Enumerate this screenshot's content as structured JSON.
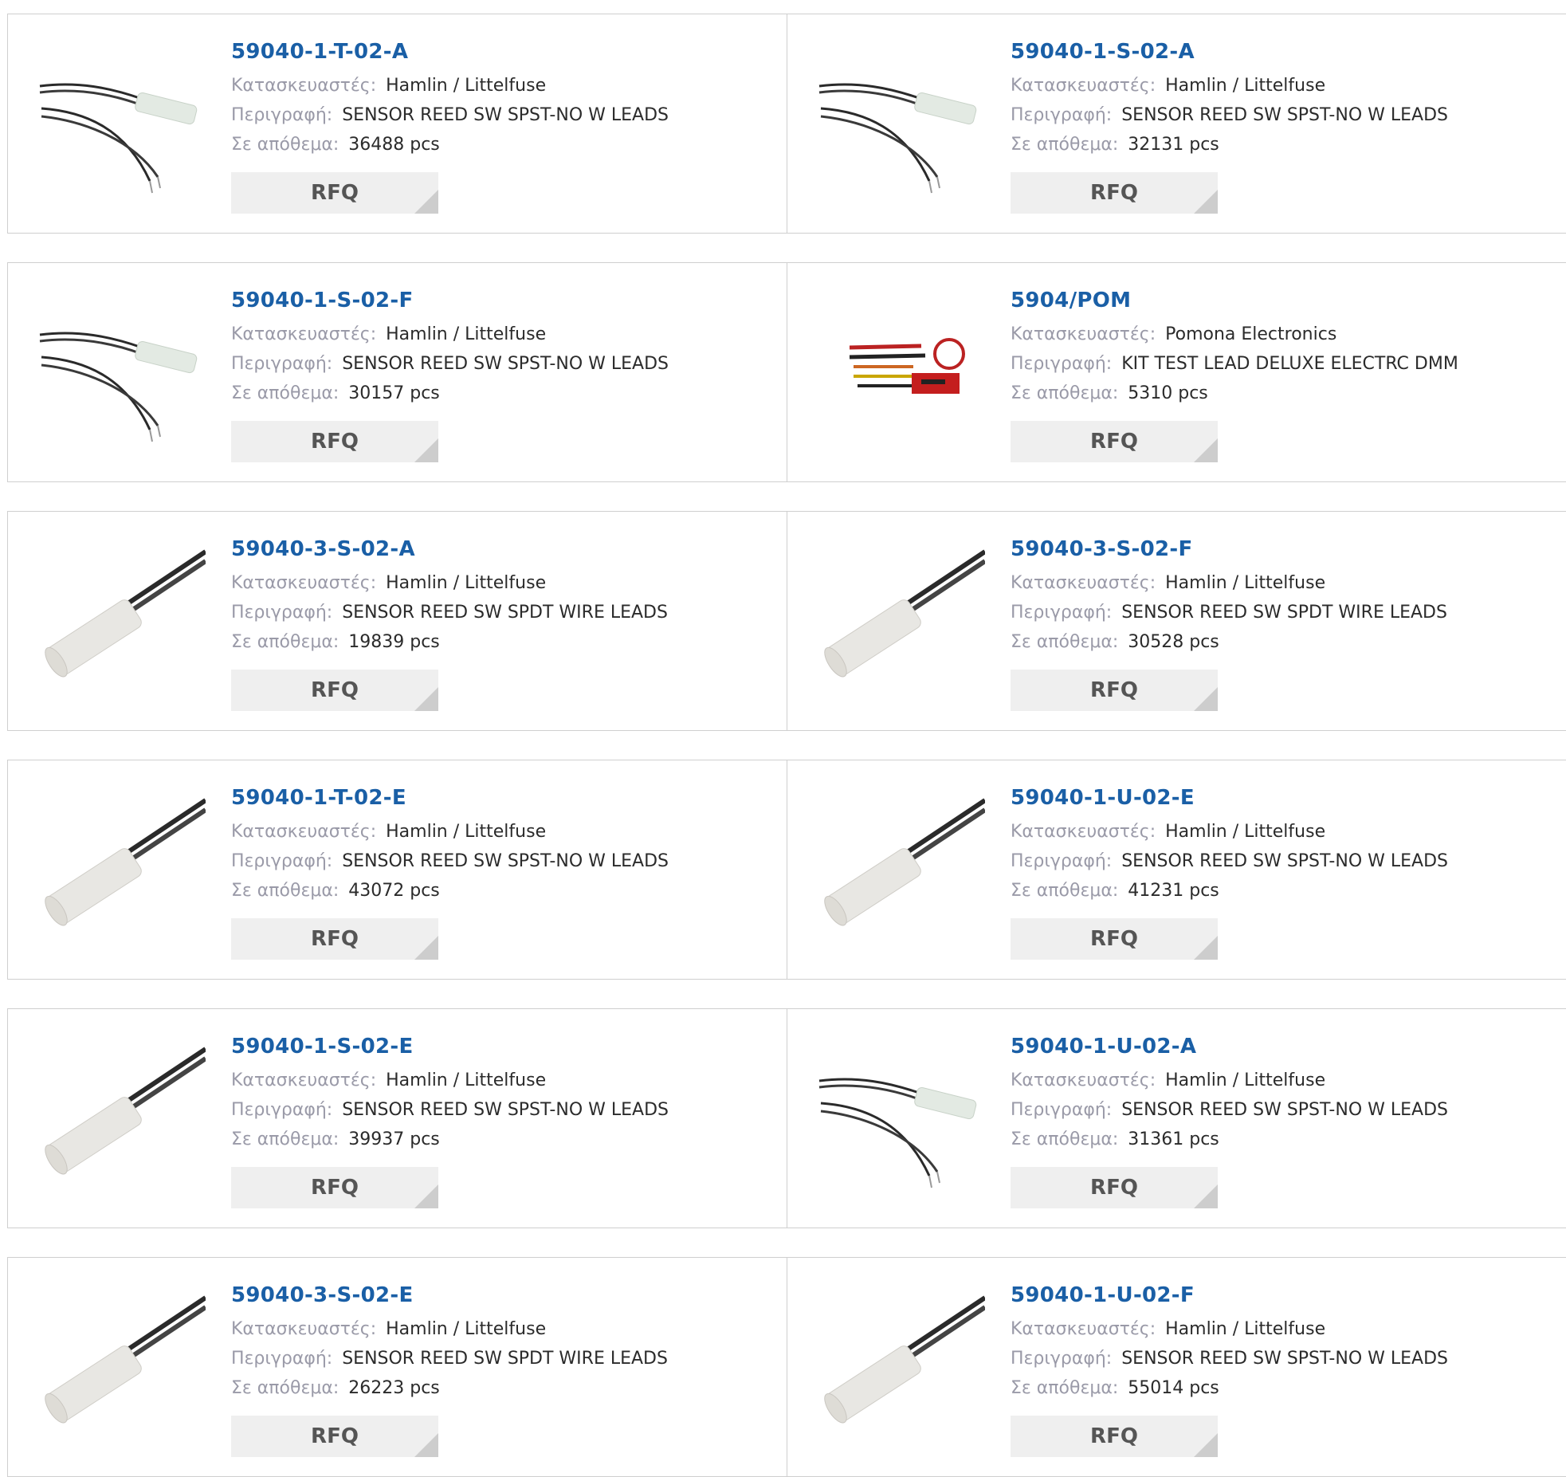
{
  "labels": {
    "manufacturer": "Κατασκευαστές:",
    "description": "Περιγραφή:",
    "stock": "Σε απόθεμα:"
  },
  "products": [
    {
      "part": "59040-1-T-02-A",
      "manufacturer": "Hamlin / Littelfuse",
      "description": "SENSOR REED SW SPST-NO W LEADS",
      "stock": "36488 pcs",
      "rfq": "RFQ",
      "image_icon": "reed-sensor-leads"
    },
    {
      "part": "59040-1-S-02-A",
      "manufacturer": "Hamlin / Littelfuse",
      "description": "SENSOR REED SW SPST-NO W LEADS",
      "stock": "32131 pcs",
      "rfq": "RFQ",
      "image_icon": "reed-sensor-leads"
    },
    {
      "part": "59040-1-S-02-F",
      "manufacturer": "Hamlin / Littelfuse",
      "description": "SENSOR REED SW SPST-NO W LEADS",
      "stock": "30157 pcs",
      "rfq": "RFQ",
      "image_icon": "reed-sensor-leads"
    },
    {
      "part": "5904/POM",
      "manufacturer": "Pomona Electronics",
      "description": "KIT TEST LEAD DELUXE ELECTRC DMM",
      "stock": "5310 pcs",
      "rfq": "RFQ",
      "image_icon": "test-lead-kit"
    },
    {
      "part": "59040-3-S-02-A",
      "manufacturer": "Hamlin / Littelfuse",
      "description": "SENSOR REED SW SPDT WIRE LEADS",
      "stock": "19839 pcs",
      "rfq": "RFQ",
      "image_icon": "reed-sensor-cylinder"
    },
    {
      "part": "59040-3-S-02-F",
      "manufacturer": "Hamlin / Littelfuse",
      "description": "SENSOR REED SW SPDT WIRE LEADS",
      "stock": "30528 pcs",
      "rfq": "RFQ",
      "image_icon": "reed-sensor-cylinder"
    },
    {
      "part": "59040-1-T-02-E",
      "manufacturer": "Hamlin / Littelfuse",
      "description": "SENSOR REED SW SPST-NO W LEADS",
      "stock": "43072 pcs",
      "rfq": "RFQ",
      "image_icon": "reed-sensor-cylinder"
    },
    {
      "part": "59040-1-U-02-E",
      "manufacturer": "Hamlin / Littelfuse",
      "description": "SENSOR REED SW SPST-NO W LEADS",
      "stock": "41231 pcs",
      "rfq": "RFQ",
      "image_icon": "reed-sensor-cylinder"
    },
    {
      "part": "59040-1-S-02-E",
      "manufacturer": "Hamlin / Littelfuse",
      "description": "SENSOR REED SW SPST-NO W LEADS",
      "stock": "39937 pcs",
      "rfq": "RFQ",
      "image_icon": "reed-sensor-cylinder"
    },
    {
      "part": "59040-1-U-02-A",
      "manufacturer": "Hamlin / Littelfuse",
      "description": "SENSOR REED SW SPST-NO W LEADS",
      "stock": "31361 pcs",
      "rfq": "RFQ",
      "image_icon": "reed-sensor-leads"
    },
    {
      "part": "59040-3-S-02-E",
      "manufacturer": "Hamlin / Littelfuse",
      "description": "SENSOR REED SW SPDT WIRE LEADS",
      "stock": "26223 pcs",
      "rfq": "RFQ",
      "image_icon": "reed-sensor-cylinder"
    },
    {
      "part": "59040-1-U-02-F",
      "manufacturer": "Hamlin / Littelfuse",
      "description": "SENSOR REED SW SPST-NO W LEADS",
      "stock": "55014 pcs",
      "rfq": "RFQ",
      "image_icon": "reed-sensor-cylinder"
    }
  ],
  "colors": {
    "part_link": "#1a5fa6",
    "label_text": "#9a9aa8",
    "value_text": "#2b2b2b",
    "rfq_bg": "#efefef",
    "border": "#cfcfcf"
  }
}
